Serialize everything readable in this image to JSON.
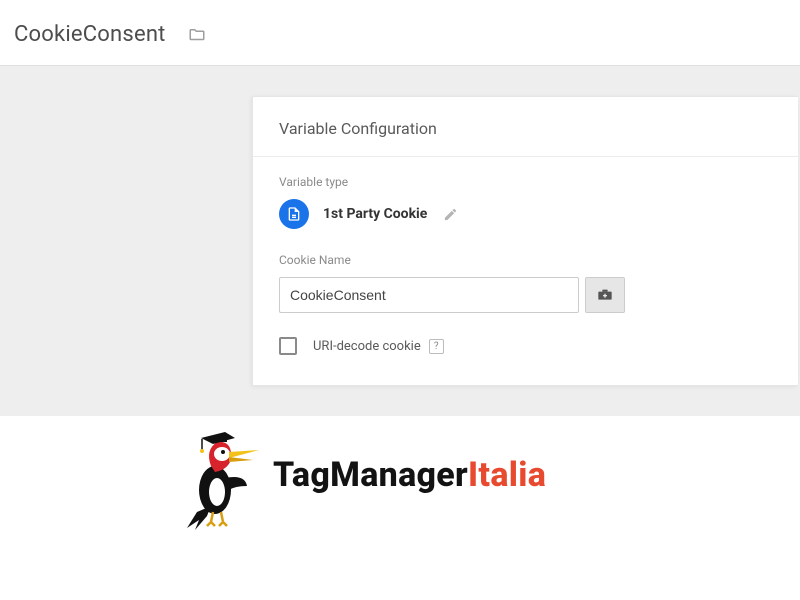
{
  "header": {
    "title": "CookieConsent"
  },
  "panel": {
    "title": "Variable Configuration",
    "variable_type_label": "Variable type",
    "variable_type": "1st Party Cookie",
    "cookie_name_label": "Cookie Name",
    "cookie_name_value": "CookieConsent",
    "uri_decode_label": "URI-decode cookie",
    "help_char": "?"
  },
  "brand": {
    "part1": "TagManager",
    "part2": "Italia"
  }
}
